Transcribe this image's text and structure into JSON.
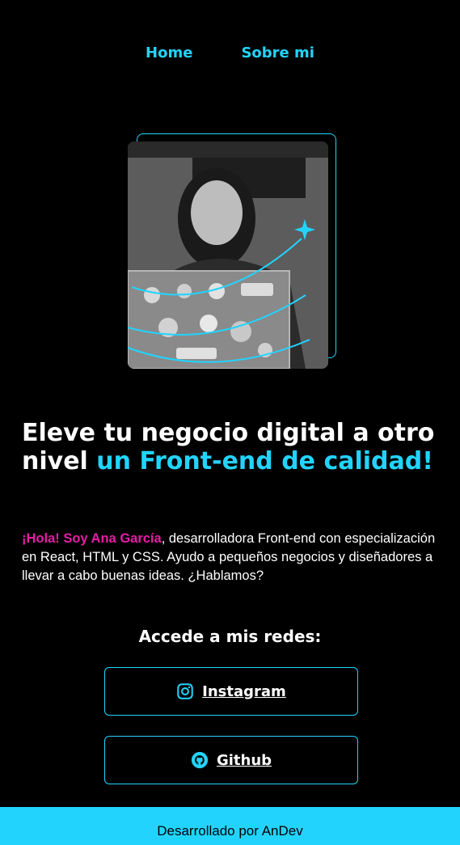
{
  "nav": {
    "items": [
      {
        "label": "Home"
      },
      {
        "label": "Sobre mi"
      }
    ]
  },
  "hero": {
    "image_icon": "portrait-photo",
    "sparkle_icon": "sparkle-icon"
  },
  "headline": {
    "part1": "Eleve tu negocio digital a otro nivel ",
    "part2": "un Front-end de calidad!"
  },
  "bio": {
    "greeting": "¡Hola! Soy Ana García",
    "text": ", desarrolladora Front-end con especialización en React, HTML y CSS. Ayudo a pequeños negocios y diseñadores a llevar a cabo buenas ideas. ¿Hablamos?"
  },
  "social": {
    "title": "Accede a mis redes:",
    "buttons": [
      {
        "label": "Instagram",
        "icon": "instagram-icon"
      },
      {
        "label": "Github",
        "icon": "github-icon"
      }
    ]
  },
  "footer": {
    "text": "Desarrollado por AnDev"
  },
  "colors": {
    "accent": "#22d4fd",
    "highlight": "#e61da6",
    "background": "#000000"
  }
}
